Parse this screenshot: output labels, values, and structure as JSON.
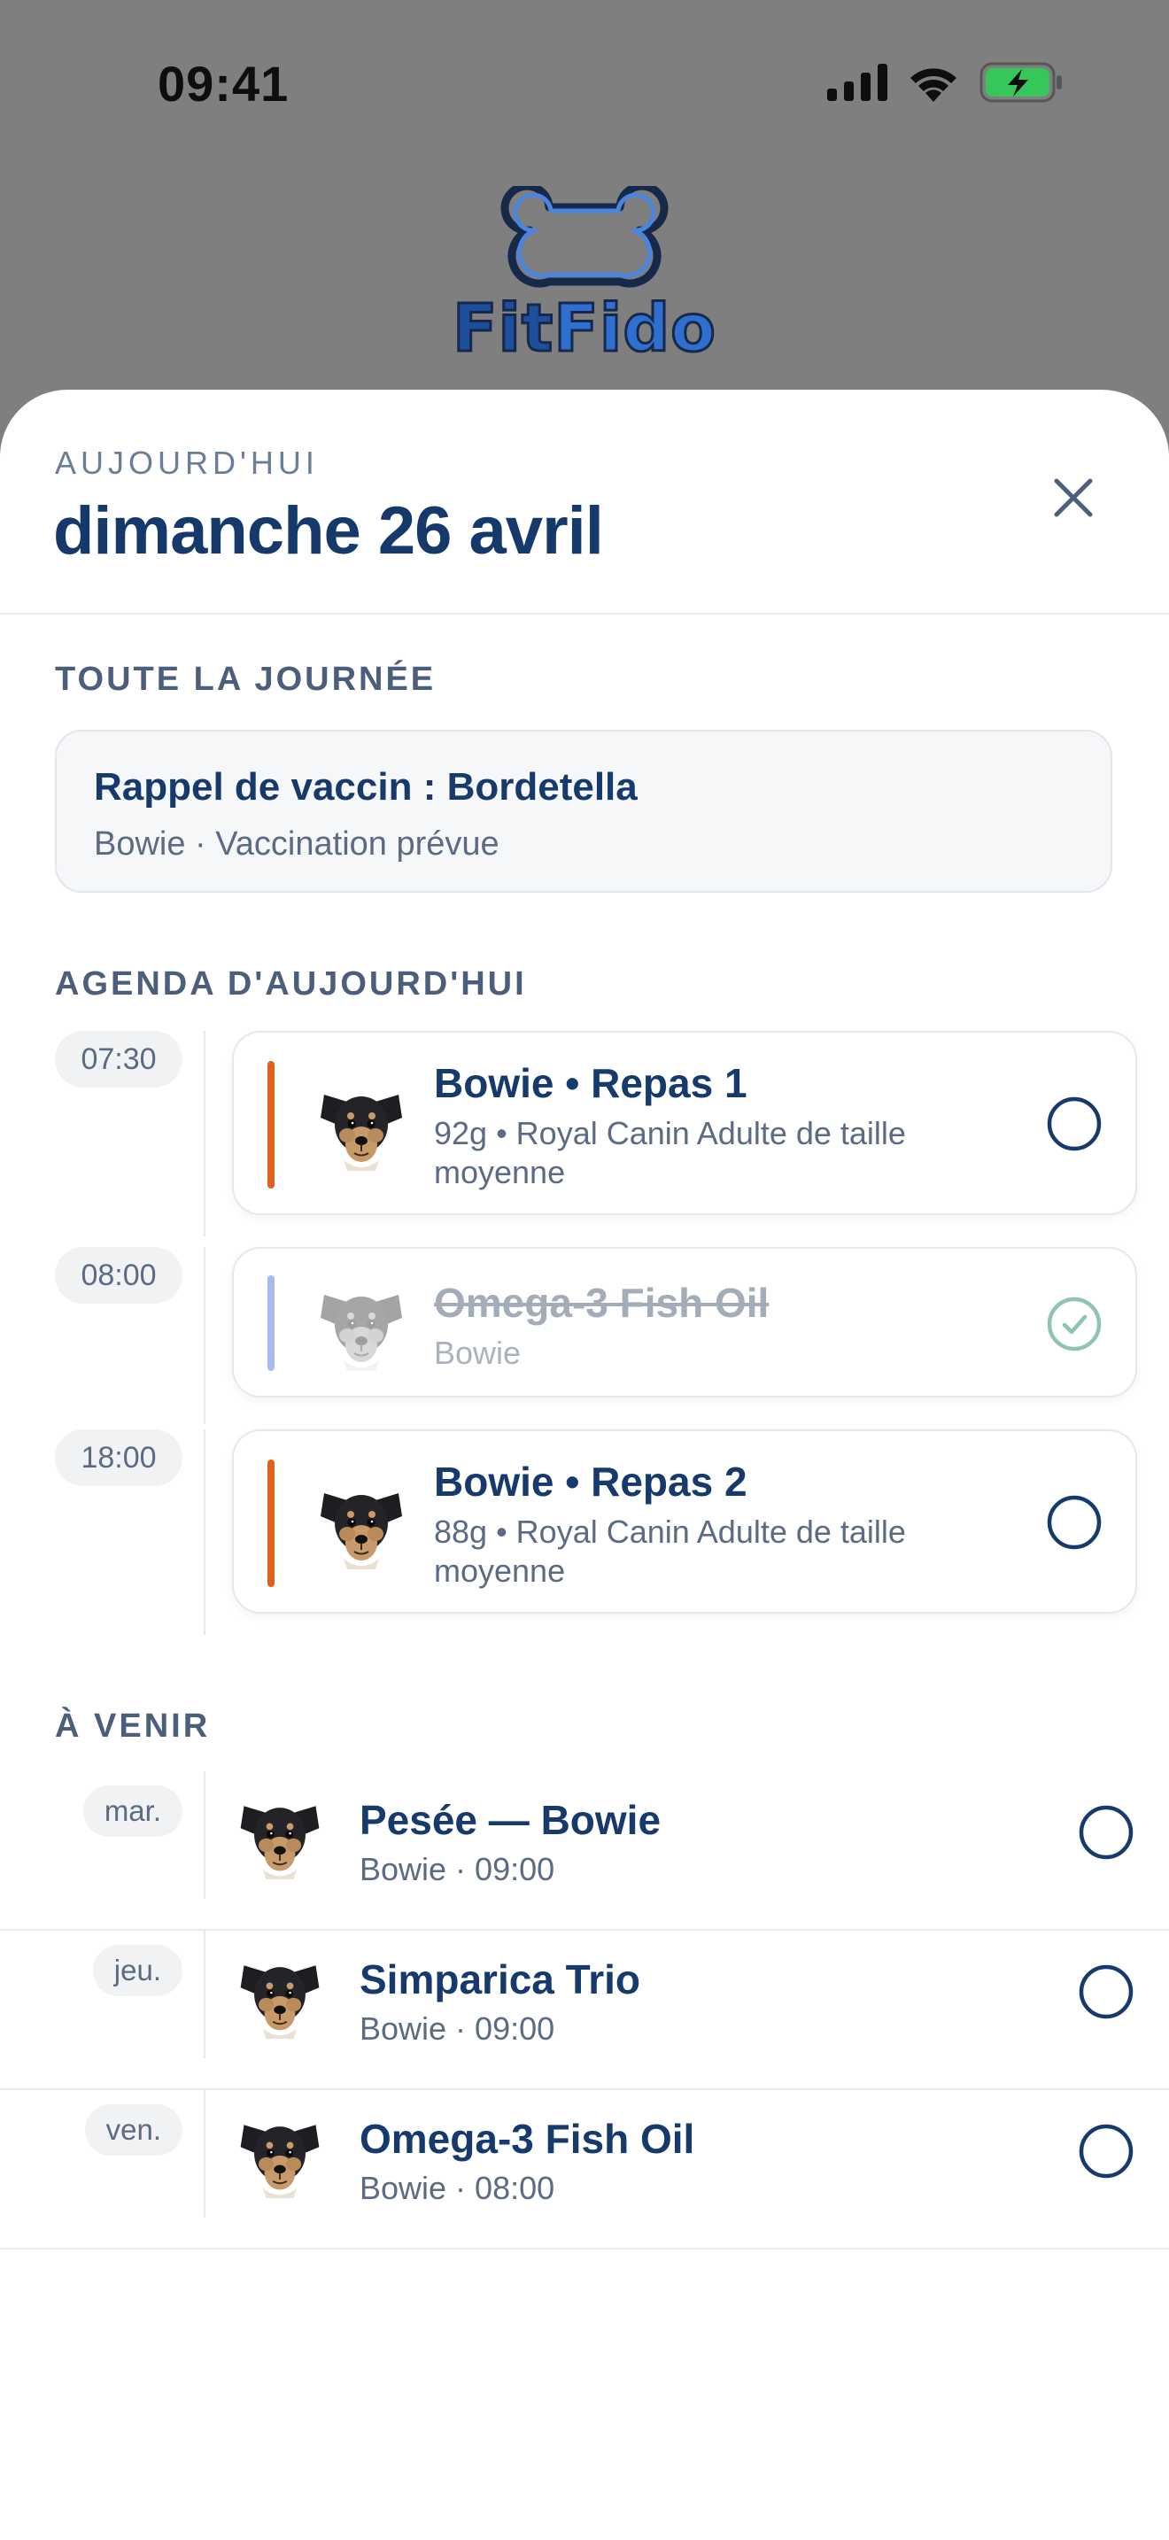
{
  "status_bar": {
    "time": "09:41",
    "icons": [
      "cellular-signal-icon",
      "wifi-icon",
      "battery-charging-icon"
    ]
  },
  "logo": {
    "part1": "Fit",
    "part2": "Fido",
    "icon": "bone-icon"
  },
  "sheet": {
    "eyebrow": "AUJOURD'HUI",
    "title": "dimanche 26 avril",
    "close_icon": "close-icon"
  },
  "all_day": {
    "label": "TOUTE LA JOURNÉE",
    "title": "Rappel de vaccin : Bordetella",
    "subtitle": "Bowie · Vaccination prévue"
  },
  "agenda": {
    "label": "AGENDA D'AUJOURD'HUI",
    "items": [
      {
        "time": "07:30",
        "title": "Bowie • Repas 1",
        "subtitle": "92g • Royal Canin Adulte de taille moyenne",
        "accent_color": "#e0621a",
        "done": false
      },
      {
        "time": "08:00",
        "title": "Omega-3 Fish Oil",
        "subtitle": "Bowie",
        "accent_color": "#a9b8ef",
        "done": true
      },
      {
        "time": "18:00",
        "title": "Bowie • Repas 2",
        "subtitle": "88g • Royal Canin Adulte de taille moyenne",
        "accent_color": "#e0621a",
        "done": false
      }
    ]
  },
  "upcoming": {
    "label": "À VENIR",
    "items": [
      {
        "day": "mar.",
        "title": "Pesée — Bowie",
        "subtitle": "Bowie · 09:00",
        "done": false
      },
      {
        "day": "jeu.",
        "title": "Simparica Trio",
        "subtitle": "Bowie · 09:00",
        "done": false
      },
      {
        "day": "ven.",
        "title": "Omega-3 Fish Oil",
        "subtitle": "Bowie · 08:00",
        "done": false
      }
    ]
  },
  "colors": {
    "navy": "#163a6c",
    "meal_accent": "#e0621a",
    "supplement_accent": "#a9b8ef",
    "done_check": "#8fc4ae",
    "overlay": "#7f7f7f"
  }
}
